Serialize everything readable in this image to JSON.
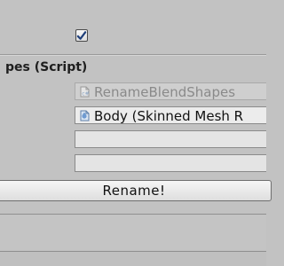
{
  "toggle": {
    "checked": true,
    "icon": "checkmark-icon"
  },
  "component": {
    "title": "pes (Script)"
  },
  "fields": {
    "script": {
      "value": "RenameBlendShapes",
      "icon": "script-asset-icon",
      "disabled": true
    },
    "target": {
      "value": "Body (Skinned Mesh R",
      "icon": "skinned-mesh-icon"
    },
    "field3": {
      "value": ""
    },
    "field4": {
      "value": ""
    }
  },
  "actions": {
    "rename_label": "Rename!"
  },
  "colors": {
    "background": "#c2c2c2",
    "field_bg": "#ececec",
    "disabled_text": "#8a8a8a",
    "check_color": "#1f3f7a"
  }
}
